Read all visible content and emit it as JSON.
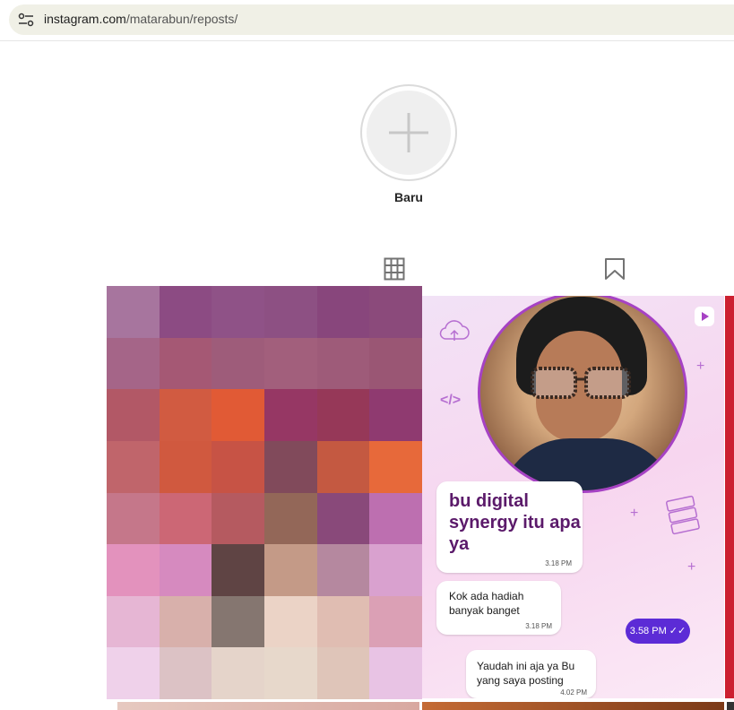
{
  "browser": {
    "url_host": "instagram.com",
    "url_path": "/matarabun/reposts/"
  },
  "highlights": {
    "new_label": "Baru"
  },
  "tabs": {
    "posts_icon": "grid-icon",
    "saved_icon": "bookmark-icon"
  },
  "posts": {
    "mosaic_colors": [
      "#a7759e",
      "#8c4b83",
      "#8f5287",
      "#8d5083",
      "#88467c",
      "#8b4a7b",
      "#a56588",
      "#a55874",
      "#9e5c7a",
      "#a25f7c",
      "#9e5b79",
      "#9a5674",
      "#b25866",
      "#d15b41",
      "#e15a35",
      "#963764",
      "#963858",
      "#8f3a70",
      "#c0656b",
      "#d0593f",
      "#c75345",
      "#814a5b",
      "#c45941",
      "#e7693a",
      "#c5778a",
      "#cc6775",
      "#b55a60",
      "#936758",
      "#89497a",
      "#bd6fb0",
      "#e392bd",
      "#d68abf",
      "#5f4444",
      "#c49a87",
      "#b5889f",
      "#d9a1cf",
      "#e6b6d4",
      "#d8b0ab",
      "#857670",
      "#ebd3c6",
      "#e0bdb2",
      "#dba0b5",
      "#efd1ea",
      "#dcc2c5",
      "#e5d4ca",
      "#e7d8cb",
      "#dfc5b9",
      "#e8c3e4"
    ],
    "promo": {
      "headline": "bu digital synergy itu apa ya",
      "headline_time": "3.18 PM",
      "msg2": "Kok ada hadiah banyak banget",
      "msg2_time": "3.18 PM",
      "msg3": "Yaudah ini aja ya Bu yang saya posting",
      "msg3_time": "4.02 PM",
      "reply_time": "3.58 PM ✓✓",
      "accent": "#5b1a6a",
      "reply_color": "#5c2bd6"
    }
  }
}
